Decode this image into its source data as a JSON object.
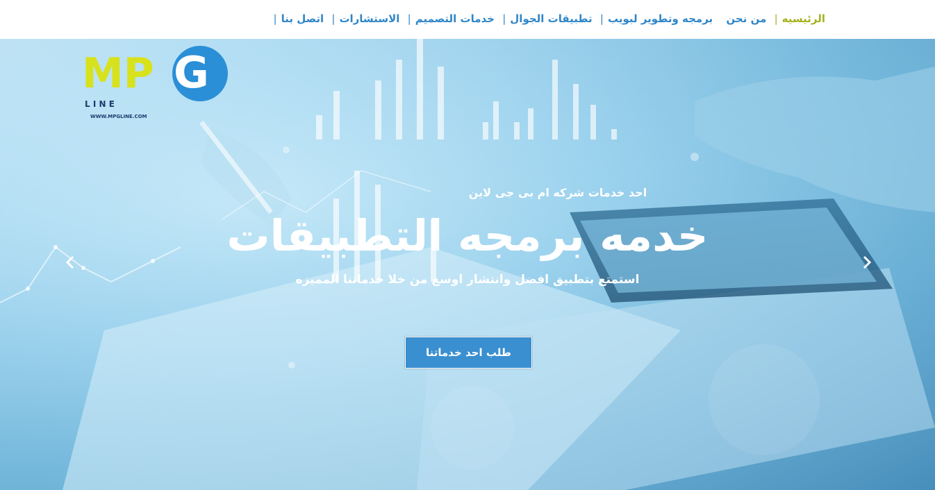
{
  "nav": {
    "items": [
      {
        "label": "الرئيسيه",
        "active": true
      },
      {
        "label": "من نحن"
      },
      {
        "label": "برمجه وتطوير لبويب"
      },
      {
        "label": "تطبيقات الجوال"
      },
      {
        "label": "خدمات التصميم"
      },
      {
        "label": "الاستشارات"
      },
      {
        "label": "اتصل بنا"
      }
    ],
    "separator": "|"
  },
  "logo": {
    "text": "MPG",
    "sub": "L I N E",
    "url": "WWW.MPGLINE.COM",
    "colors": {
      "m_p": "#d7e21c",
      "g": "#2a8fd6",
      "text": "#1d3a6e"
    }
  },
  "hero": {
    "kicker": "احد خدمات شركه ام بى جى لاين",
    "headline": "خدمه برمجه التطبيقات",
    "subhead": "استمتع بتطبيق افضل وانتشار اوسع من خلا خدماتنا المميزه",
    "cta_label": "طلب احد خدماتنا"
  },
  "colors": {
    "nav_link": "#2f86c8",
    "nav_active": "#a6b21e",
    "cta_bg": "#3a8fd0"
  },
  "icons": {
    "prev": "chevron-left-icon",
    "next": "chevron-right-icon"
  }
}
